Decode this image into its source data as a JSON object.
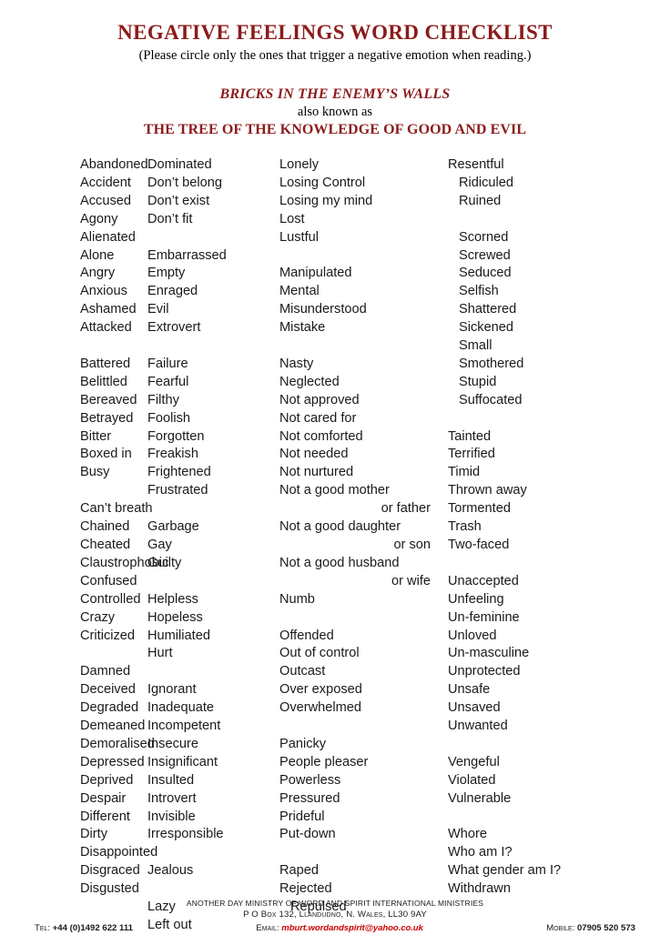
{
  "header": {
    "title": "NEGATIVE FEELINGS WORD CHECKLIST",
    "instruction": "(Please circle only the ones that trigger a negative emotion when reading.)",
    "banner_line1": "BRICKS IN THE ENEMY’S WALLS",
    "banner_line2": "also known as",
    "banner_line3": "THE TREE OF THE KNOWLEDGE OF GOOD AND EVIL",
    "accent_color": "#8c1b1b"
  },
  "columns": [
    {
      "id": "column-1",
      "groups": [
        {
          "words": [
            "Abandoned",
            "Accident",
            "Accused",
            "Agony",
            "Alienated",
            "Alone",
            "Angry",
            "Anxious",
            "Ashamed",
            "Attacked"
          ]
        },
        {
          "words": [
            "Battered",
            "Belittled",
            "Bereaved",
            "Betrayed",
            "Bitter",
            "Boxed in",
            "Busy"
          ]
        },
        {
          "words": [
            "Can’t breath",
            "Chained",
            "Cheated",
            "Claustrophobic",
            "Confused",
            "Controlled",
            "Crazy",
            "Criticized"
          ]
        },
        {
          "words": [
            "Damned",
            "Deceived",
            "Degraded",
            "Demeaned",
            "Demoralised",
            "Depressed",
            "Deprived",
            "Despair",
            "Different",
            "Dirty",
            "Disappointed",
            "Disgraced",
            "Disgusted"
          ]
        }
      ]
    },
    {
      "id": "column-2",
      "groups": [
        {
          "words": [
            "Dominated",
            "Don’t belong",
            "Don’t exist",
            "Don’t fit"
          ]
        },
        {
          "words": [
            "Embarrassed",
            "Empty",
            "Enraged",
            "Evil",
            "Extrovert"
          ]
        },
        {
          "words": [
            "Failure",
            "Fearful",
            "Filthy",
            "Foolish",
            "Forgotten",
            "Freakish",
            "Frightened",
            "Frustrated"
          ]
        },
        {
          "words": [
            "Garbage",
            "Gay",
            "Guilty"
          ]
        },
        {
          "words": [
            "Helpless",
            "Hopeless",
            "Humiliated",
            "Hurt"
          ]
        },
        {
          "words": [
            "Ignorant",
            "Inadequate",
            "Incompetent",
            "Insecure",
            "Insignificant",
            "Insulted",
            "Introvert",
            "Invisible",
            "Irresponsible"
          ]
        },
        {
          "words": [
            "Jealous"
          ]
        },
        {
          "words": [
            "Lazy",
            "Left out"
          ]
        }
      ]
    },
    {
      "id": "column-3",
      "groups": [
        {
          "words": [
            "Lonely",
            "Losing Control",
            "Losing my mind",
            "Lost",
            "Lustful"
          ]
        },
        {
          "words": [
            "Manipulated",
            "Mental",
            "Misunderstood",
            "Mistake"
          ]
        },
        {
          "words": [
            "Nasty",
            "Neglected",
            "Not approved",
            "Not cared for",
            "Not comforted",
            "Not needed",
            "Not nurtured",
            "Not a good mother",
            "or father",
            "Not a good daughter",
            "or son",
            "Not a good husband",
            "or wife",
            "Numb"
          ],
          "continuations": [
            8,
            10,
            12
          ]
        },
        {
          "words": [
            "Offended",
            "Out of control",
            "Outcast",
            "Over exposed",
            "Overwhelmed"
          ]
        },
        {
          "words": [
            "Panicky",
            "People pleaser",
            "Powerless",
            "Pressured",
            "Prideful",
            "Put-down"
          ]
        },
        {
          "words": [
            "Raped",
            "Rejected",
            "Repulsed"
          ],
          "indented": [
            2
          ]
        }
      ]
    },
    {
      "id": "column-4",
      "groups": [
        {
          "words": [
            "Resentful",
            "Ridiculed",
            "Ruined"
          ],
          "indented": [
            1,
            2
          ]
        },
        {
          "words": [
            "Scorned",
            "Screwed",
            "Seduced",
            "Selfish",
            "Shattered",
            "Sickened",
            "Small",
            "Smothered",
            "Stupid",
            "Suffocated"
          ],
          "indented": [
            0,
            1,
            2,
            3,
            4,
            5,
            6,
            7,
            8,
            9
          ]
        },
        {
          "words": [
            "Tainted",
            "Terrified",
            "Timid",
            "Thrown away",
            "Tormented",
            "Trash",
            "Two-faced"
          ]
        },
        {
          "words": [
            "Unaccepted",
            "Unfeeling",
            "Un-feminine",
            "Unloved",
            "Un-masculine",
            "Unprotected",
            "Unsafe",
            "Unsaved",
            "Unwanted"
          ]
        },
        {
          "words": [
            "Vengeful",
            "Violated",
            "Vulnerable"
          ]
        },
        {
          "words": [
            "Whore",
            "Who am I?",
            "What gender am I?",
            "Withdrawn"
          ]
        }
      ]
    }
  ],
  "footer": {
    "organisation": "ANOTHER DAY MINISTRY OF WORD AND SPIRIT INTERNATIONAL MINISTRIES",
    "address": "P O Box 132, Llandudno, N. Wales, LL30 9AY",
    "tel_label": "Tel:",
    "tel_value": "+44 (0)1492 622 111",
    "email_label": "Email:",
    "email_value": "mburt.wordandspirit@yahoo.co.uk",
    "mobile_label": "Mobile:",
    "mobile_value": "07905 520 573",
    "email_color": "#cc0000"
  }
}
